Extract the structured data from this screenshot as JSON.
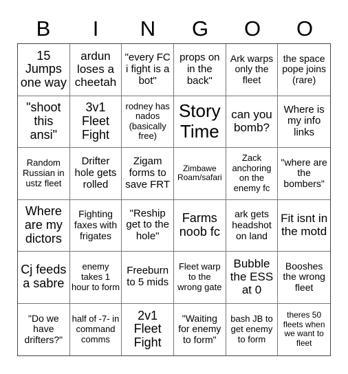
{
  "header": [
    "B",
    "I",
    "N",
    "G",
    "O",
    "O"
  ],
  "cells": [
    "15 Jumps one way",
    "ardun loses a cheetah",
    "\"every FC i fight is a bot\"",
    "props on in the back\"",
    "Ark warps only the fleet",
    "the space pope joins (rare)",
    "\"shoot this ansi\"",
    "3v1 Fleet Fight",
    "rodney has nados (basically free)",
    "Story Time",
    "can you bomb?",
    "Where is my info links",
    "Random Russian in ustz fleet",
    "Drifter hole gets rolled",
    "Zigam forms to save FRT",
    "Zimbawe Roam/safari",
    "Zack anchoring on the enemy fc",
    "\"where are the bombers\"",
    "Where are my dictors",
    "Fighting faxes with frigates",
    "\"Reship get to the hole\"",
    "Farms noob fc",
    "ark gets headshot on land",
    "Fit isnt in the motd",
    "Cj feeds a sabre",
    "enemy takes 1 hour to form",
    "Freeburn to 5 mids",
    "Fleet warp to the wrong gate",
    "Bubble the ESS at 0",
    "Booshes the wrong fleet",
    "\"Do we have drifters?\"",
    "half of -7- in command comms",
    "2v1 Fleet Fight",
    "\"Waiting for enemy to form\"",
    "bash JB to get enemy to form",
    "theres 50 fleets when we want to fleet"
  ]
}
